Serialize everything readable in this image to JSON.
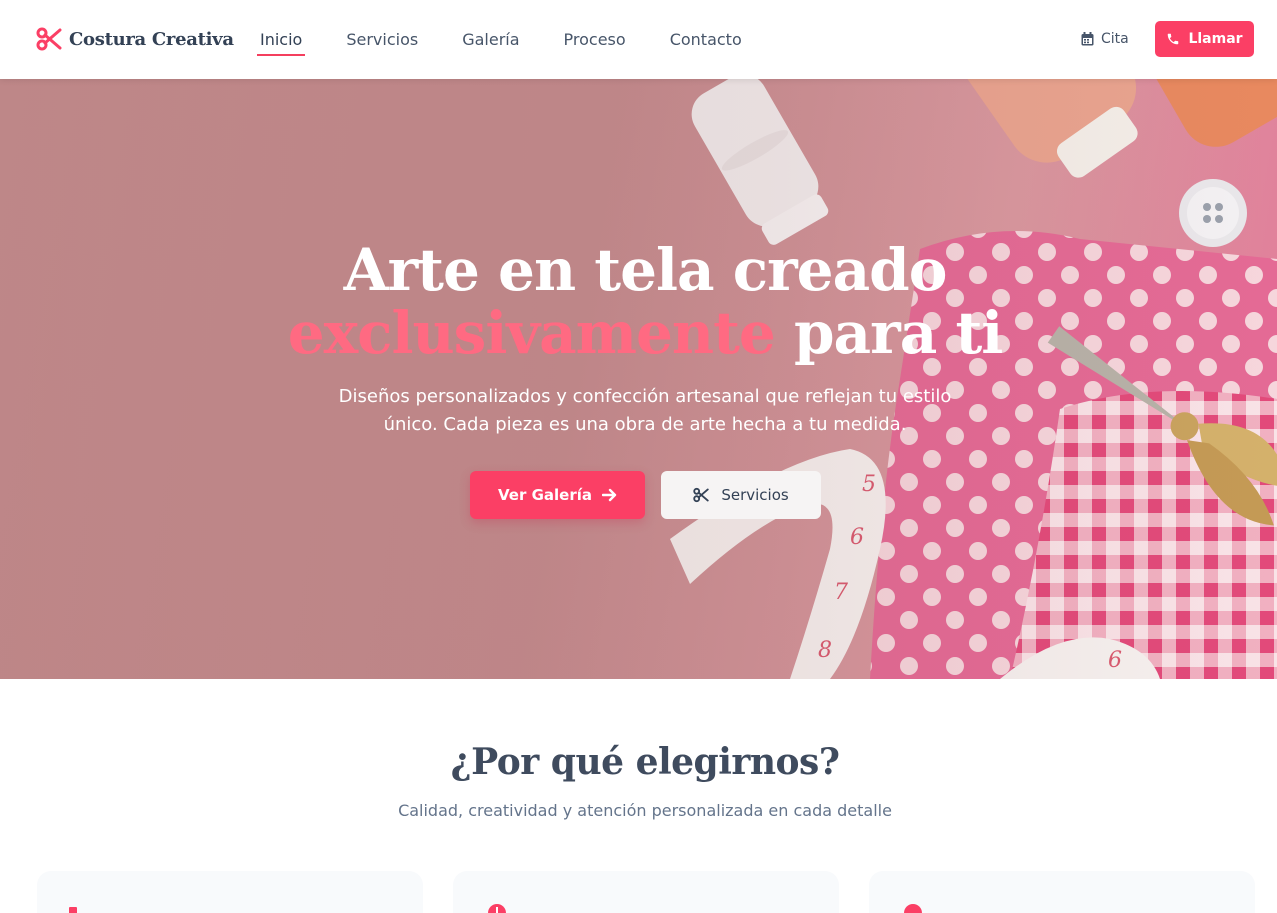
{
  "brand": {
    "name": "Costura Creativa",
    "icon": "scissors-icon",
    "color": "#fb3f65"
  },
  "nav": {
    "items": [
      {
        "label": "Inicio",
        "active": true
      },
      {
        "label": "Servicios",
        "active": false
      },
      {
        "label": "Galería",
        "active": false
      },
      {
        "label": "Proceso",
        "active": false
      },
      {
        "label": "Contacto",
        "active": false
      }
    ]
  },
  "header_actions": {
    "cita_label": "Cita",
    "cita_icon": "calendar-icon",
    "llamar_label": "Llamar",
    "llamar_icon": "phone-icon"
  },
  "hero": {
    "title_line1": "Arte en tela creado",
    "title_accent": "exclusivamente",
    "title_rest": "para ti",
    "subtitle_line1": "Diseños personalizados y confección artesanal que reflejan tu estilo",
    "subtitle_line2": "único. Cada pieza es una obra de arte hecha a tu medida.",
    "primary_button": "Ver Galería",
    "secondary_button": "Servicios",
    "accent_color": "#ff6a82"
  },
  "why": {
    "title": "¿Por qué elegirnos?",
    "subtitle": "Calidad, creatividad y atención personalizada en cada detalle",
    "cards": [
      {
        "icon": "ruler-icon"
      },
      {
        "icon": "clock-icon"
      },
      {
        "icon": "award-icon"
      }
    ]
  }
}
